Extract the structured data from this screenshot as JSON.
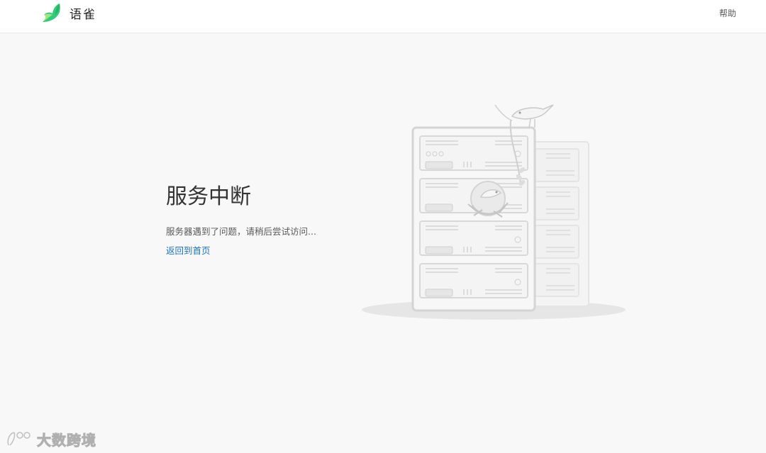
{
  "header": {
    "brand_name": "语雀",
    "help_label": "帮助",
    "logo_icon": "yuque-bird-logo-icon",
    "brand_color": "#31cc79"
  },
  "main": {
    "title": "服务中断",
    "description": "服务器遇到了问题，请稍后尝试访问...",
    "home_link_label": "返回到首页",
    "link_color": "#1f73c3",
    "illustration_icon": "server-rack-bird-illustration"
  },
  "watermark": {
    "text": "大数跨境",
    "icon": "watermark-logo-icon"
  }
}
